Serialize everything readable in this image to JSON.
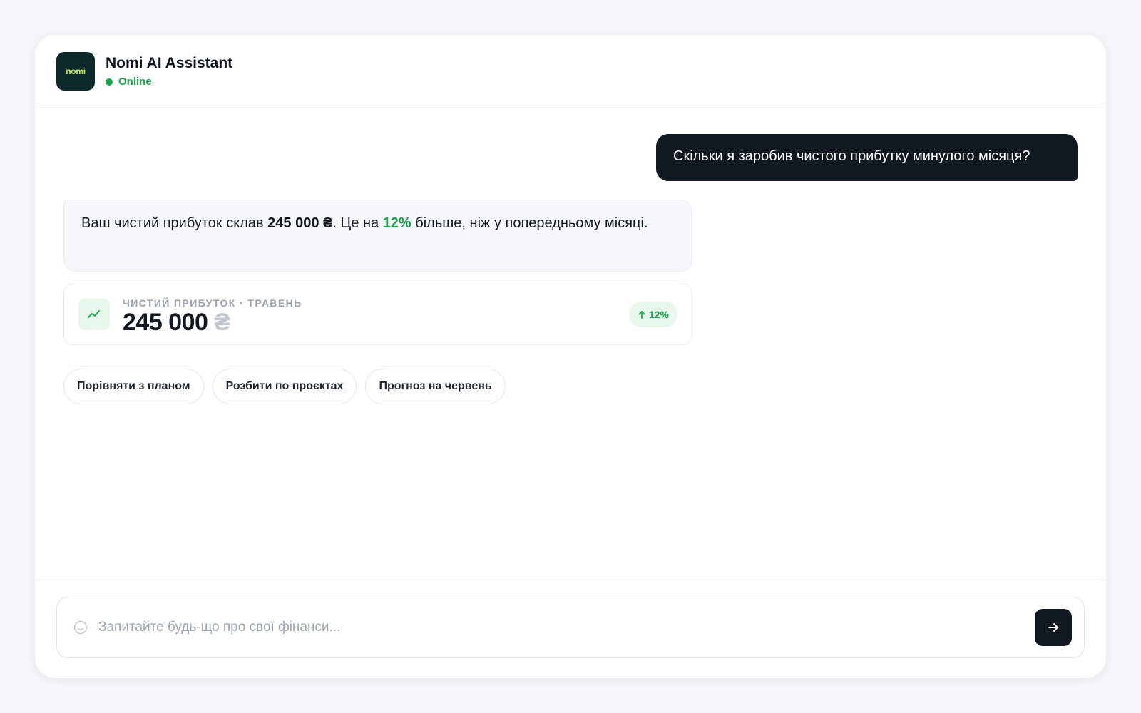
{
  "header": {
    "logo_text": "nomi",
    "title": "Nomi AI Assistant",
    "status": "Online",
    "status_color": "#19a34a"
  },
  "messages": {
    "user": "Скільки я заробив чистого прибутку минулого місяця?",
    "assistant": {
      "prefix": "Ваш чистий прибуток склав ",
      "amount": "245 000 ₴",
      "middle": ". Це на ",
      "percent": "12%",
      "suffix": " більше, ніж у попередньому місяці."
    }
  },
  "stat_card": {
    "icon": "trending-up-icon",
    "label": "Чистий прибуток · травень",
    "value": "245 000",
    "currency": "₴",
    "badge": "12%",
    "badge_icon": "arrow-up-icon"
  },
  "suggestions": [
    "Порівняти з планом",
    "Розбити по проєктах",
    "Прогноз на червень"
  ],
  "composer": {
    "placeholder": "Запитайте будь-що про свої фінанси...",
    "value": "",
    "emoji_icon": "smiley-icon",
    "send_icon": "arrow-right-icon"
  },
  "colors": {
    "accent": "#19a34a",
    "dark": "#111821",
    "background": "#f4f6f9"
  }
}
